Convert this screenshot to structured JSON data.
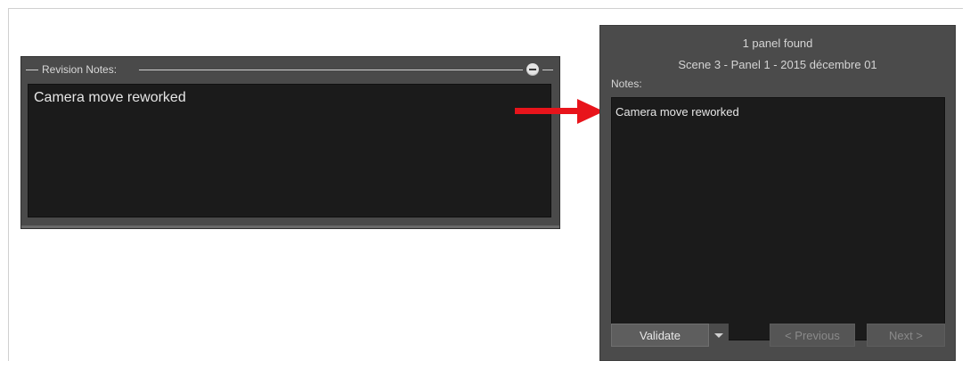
{
  "revision_notes": {
    "title": "Revision Notes:",
    "text": "Camera move reworked"
  },
  "dialog": {
    "found": "1 panel found",
    "scene": "Scene 3 - Panel 1 - 2015 décembre 01",
    "notes_label": "Notes:",
    "notes_text": "Camera move reworked",
    "buttons": {
      "validate": "Validate",
      "previous": "< Previous",
      "next": "Next >"
    }
  },
  "colors": {
    "arrow": "#e8141b",
    "panel_bg": "#4a4a4a",
    "text_area_bg": "#1b1b1b"
  },
  "icons": {
    "collapse": "minus-circle-icon",
    "dropdown": "chevron-down-icon",
    "arrow": "arrow-right-icon"
  }
}
